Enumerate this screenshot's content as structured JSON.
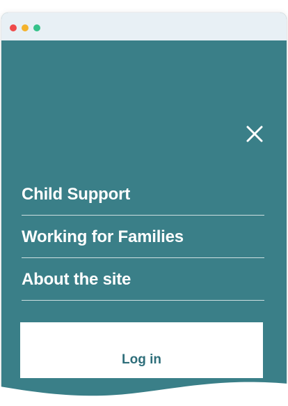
{
  "window": {
    "controls": [
      "close",
      "minimize",
      "maximize"
    ]
  },
  "menu": {
    "close_icon": "close-icon",
    "items": [
      {
        "label": "Child Support"
      },
      {
        "label": "Working for Families"
      },
      {
        "label": "About the site"
      }
    ],
    "login_label": "Log in"
  },
  "colors": {
    "panel": "#3a7f88",
    "titlebar": "#e8f0f5",
    "login_text": "#2e6e7a",
    "dot_red": "#ef4a4a",
    "dot_yellow": "#f4b32d",
    "dot_green": "#35c28a"
  }
}
